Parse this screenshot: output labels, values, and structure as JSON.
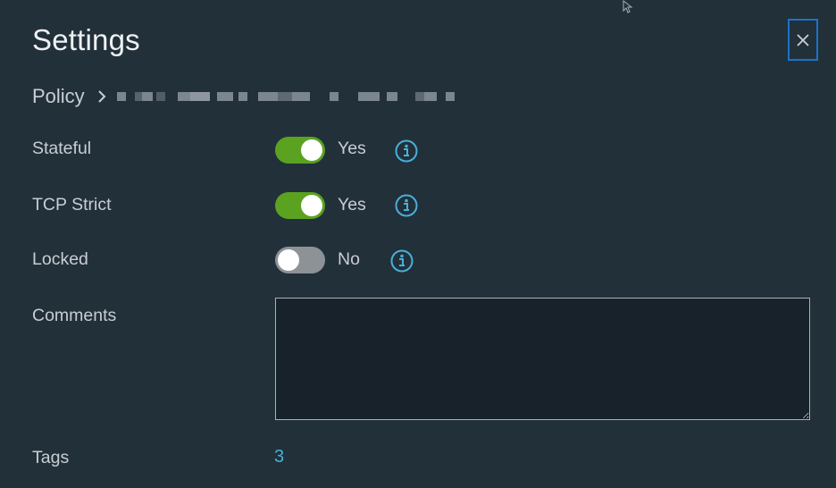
{
  "dialog": {
    "title": "Settings",
    "close_label": "Close"
  },
  "breadcrumb": {
    "root": "Policy"
  },
  "fields": {
    "stateful": {
      "label": "Stateful",
      "value": "Yes",
      "enabled": true
    },
    "tcp_strict": {
      "label": "TCP Strict",
      "value": "Yes",
      "enabled": true
    },
    "locked": {
      "label": "Locked",
      "value": "No",
      "enabled": false
    },
    "comments": {
      "label": "Comments",
      "value": "",
      "placeholder": ""
    },
    "tags": {
      "label": "Tags",
      "count": "3"
    }
  },
  "colors": {
    "background": "#22303a",
    "toggle_on": "#5aa220",
    "toggle_off": "#8c9296",
    "info_icon": "#49afd9",
    "link": "#49afd9",
    "close_focus": "#1a73c8"
  },
  "icons": {
    "close": "close-icon",
    "breadcrumb_separator": "chevron-right-icon",
    "info": "info-icon",
    "cursor": "mouse-pointer-icon"
  }
}
